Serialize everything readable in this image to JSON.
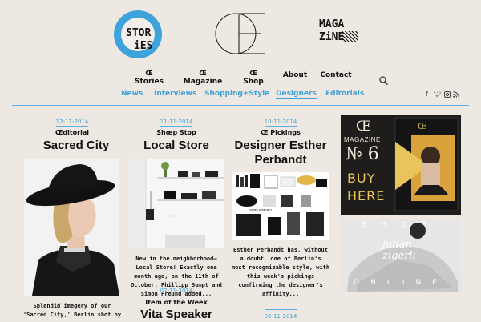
{
  "header": {
    "logo_stories": {
      "line1": "STOR",
      "line2": "iES"
    },
    "logo_magazine": {
      "line1": "MAGA",
      "line2": "ZiNE"
    },
    "logo_oe": "Œ"
  },
  "nav": {
    "main": [
      {
        "symbol": "Œ",
        "label": "Stories"
      },
      {
        "symbol": "Œ",
        "label": "Magazine"
      },
      {
        "symbol": "Œ",
        "label": "Shop"
      },
      {
        "symbol": "",
        "label": "About"
      },
      {
        "symbol": "",
        "label": "Contact"
      }
    ],
    "sub": [
      "News",
      "Interviews",
      "Shopping+Style",
      "Designers",
      "Editorials"
    ],
    "social_icons": [
      "facebook-icon",
      "twitter-icon",
      "instagram-icon",
      "rss-icon"
    ]
  },
  "colors": {
    "accent": "#3ea3da",
    "background": "#eee8e2"
  },
  "posts": [
    {
      "date": "12-11-2014",
      "kicker": "Œditorial",
      "title": "Sacred City",
      "excerpt": [
        "Splendid imegery of our",
        "‘Sacred City,’ Berlin shot by"
      ]
    },
    {
      "date": "11-11-2014",
      "kicker": "Shœp Stop",
      "title": "Local Store",
      "excerpt": [
        "New in the neighborhood—",
        "Local Store! Exactly one",
        "month ago, on the 11th of",
        "October, Phillipp Sumpt and",
        "Simon Freund added..."
      ]
    },
    {
      "date": "10-11-2014",
      "kicker": "Œ Pickings",
      "title": "Designer Esther",
      "title2": "Perbandt",
      "excerpt": [
        "Esther Perbandt has, without",
        "a doubt, one of Berlin's",
        "most recognizable style, with",
        "this week's pickings",
        "confirming the designer's",
        "affinity..."
      ]
    },
    {
      "date": "07-11-2014",
      "kicker": "Item of the Week",
      "title": "Vita Speaker"
    },
    {
      "date": "06-11-2014"
    }
  ],
  "ads": {
    "magazine": {
      "logo": "Œ",
      "word": "MAGAZINE",
      "issue": "№ 6",
      "cta1": "BUY",
      "cta2": "HERE"
    },
    "shop": {
      "top": "SHOP",
      "bottom": "ONLINE",
      "brand1": "julian",
      "brand2": "zigerli"
    }
  },
  "picking_label": "ESTHER PERBANDT"
}
